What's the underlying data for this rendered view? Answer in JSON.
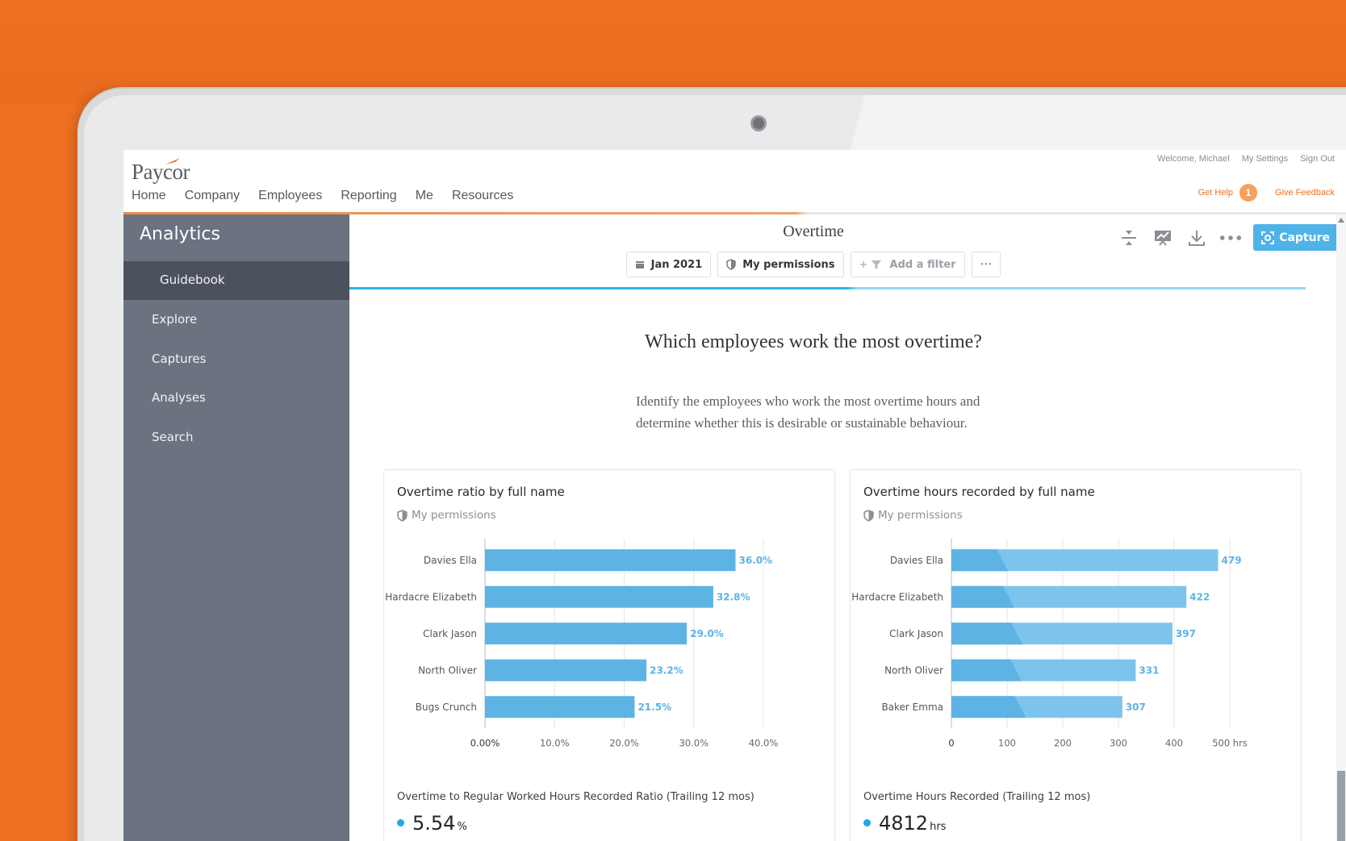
{
  "brand": {
    "logo_text": "Paycor",
    "accent": "#ee7020",
    "capture_blue": "#4fb3e8",
    "bar_blue": "#5db3e4",
    "bar_blue_light": "#7cc4ec"
  },
  "nav": {
    "items": [
      "Home",
      "Company",
      "Employees",
      "Reporting",
      "Me",
      "Resources"
    ]
  },
  "utility": {
    "welcome": "Welcome, Michael",
    "settings": "My Settings",
    "sign_out": "Sign Out",
    "get_help": "Get Help",
    "help_count": "1",
    "feedback": "Give Feedback"
  },
  "sidebar": {
    "title": "Analytics",
    "items": [
      {
        "label": "Guidebook",
        "active": true
      },
      {
        "label": "Explore"
      },
      {
        "label": "Captures"
      },
      {
        "label": "Analyses"
      },
      {
        "label": "Search"
      }
    ]
  },
  "main": {
    "title": "Overtime",
    "capture_label": "Capture",
    "filters": {
      "date": "Jan 2021",
      "permissions": "My permissions",
      "add_filter": "Add a filter",
      "more": "···"
    },
    "question": "Which employees work the most overtime?",
    "description_line1": "Identify the employees who work the most overtime hours and",
    "description_line2": "determine whether this is desirable or sustainable behaviour."
  },
  "cards": [
    {
      "title": "Overtime ratio by full name",
      "permissions": "My permissions",
      "footer": "Overtime to Regular Worked Hours Recorded Ratio (Trailing 12 mos)",
      "metric_value": "5.54",
      "metric_unit": "%"
    },
    {
      "title": "Overtime hours recorded by full name",
      "permissions": "My permissions",
      "footer": "Overtime Hours Recorded (Trailing 12 mos)",
      "metric_value": "4812",
      "metric_unit": "hrs"
    }
  ],
  "chart_data": [
    {
      "type": "bar",
      "orientation": "horizontal",
      "title": "Overtime ratio by full name",
      "categories": [
        "Davies Ella",
        "Hardacre Elizabeth",
        "Clark Jason",
        "North Oliver",
        "Bugs Crunch"
      ],
      "values": [
        36.0,
        32.8,
        29.0,
        23.2,
        21.5
      ],
      "value_labels": [
        "36.0%",
        "32.8%",
        "29.0%",
        "23.2%",
        "21.5%"
      ],
      "x_ticks": [
        "0.00%",
        "10.0%",
        "20.0%",
        "30.0%",
        "40.0%"
      ],
      "xlim": [
        0,
        40
      ],
      "grid": true
    },
    {
      "type": "bar",
      "orientation": "horizontal",
      "title": "Overtime hours recorded by full name",
      "categories": [
        "Davies Ella",
        "Hardacre Elizabeth",
        "Clark Jason",
        "North Oliver",
        "Baker Emma"
      ],
      "values": [
        479,
        422,
        397,
        331,
        307
      ],
      "value_labels": [
        "479",
        "422",
        "397",
        "331",
        "307"
      ],
      "x_ticks": [
        "0",
        "100",
        "200",
        "300",
        "400",
        "500 hrs"
      ],
      "xlim": [
        0,
        500
      ],
      "grid": true
    }
  ]
}
